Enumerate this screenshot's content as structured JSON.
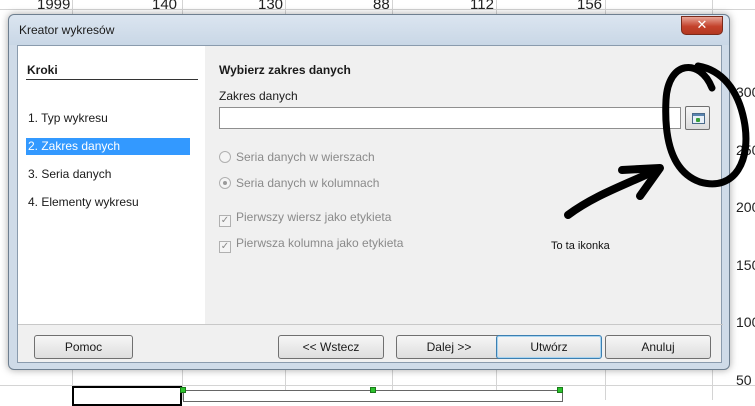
{
  "spreadsheet": {
    "top_row_values": [
      "1999",
      "140",
      "130",
      "88",
      "112",
      "156"
    ],
    "axis_labels": [
      "300",
      "250",
      "200",
      "150",
      "100",
      "50"
    ]
  },
  "dialog": {
    "title": "Kreator wykresów",
    "close_glyph": "✕",
    "sidebar": {
      "title": "Kroki",
      "steps": [
        {
          "label": "1. Typ wykresu",
          "active": false
        },
        {
          "label": "2. Zakres danych",
          "active": true
        },
        {
          "label": "3. Seria danych",
          "active": false
        },
        {
          "label": "4. Elementy wykresu",
          "active": false
        }
      ]
    },
    "main": {
      "section_title": "Wybierz zakres danych",
      "range_label": "Zakres danych",
      "range_value": "",
      "shrink_icon": "shrink-dialog-icon",
      "radio_rows": "Seria danych w wierszach",
      "radio_columns": "Seria danych w kolumnach",
      "check_first_row": "Pierwszy wiersz jako etykieta",
      "check_first_column": "Pierwsza kolumna jako etykieta"
    },
    "buttons": {
      "help": "Pomoc",
      "back": "<< Wstecz",
      "next": "Dalej >>",
      "finish": "Utwórz",
      "cancel": "Anuluj"
    }
  },
  "annotation": {
    "text": "To ta ikonka",
    "color": "#000000"
  }
}
